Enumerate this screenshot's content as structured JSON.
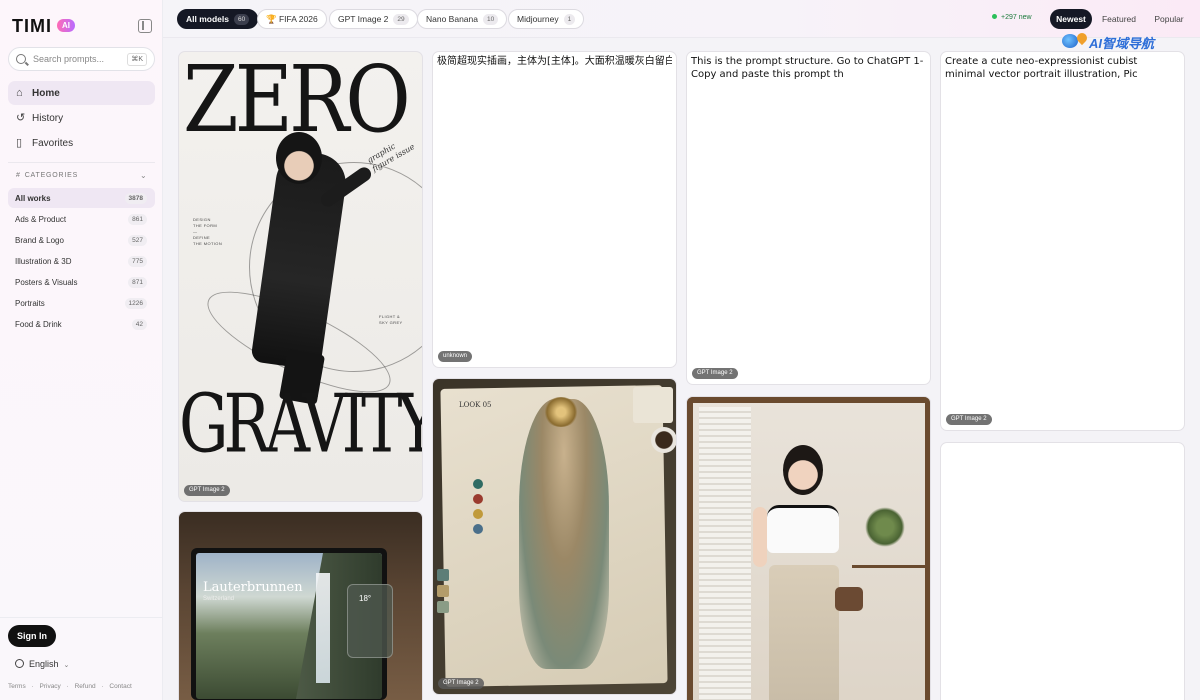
{
  "app": {
    "logo_text": "TIMI",
    "logo_badge": "AI"
  },
  "search": {
    "placeholder": "Search prompts...",
    "shortcut": "⌘K"
  },
  "nav": {
    "items": [
      {
        "label": "Home",
        "icon": "home-icon"
      },
      {
        "label": "History",
        "icon": "history-icon"
      },
      {
        "label": "Favorites",
        "icon": "bookmark-icon"
      }
    ]
  },
  "categories": {
    "heading": "CATEGORIES",
    "items": [
      {
        "label": "All works",
        "count": "3878"
      },
      {
        "label": "Ads & Product",
        "count": "861"
      },
      {
        "label": "Brand & Logo",
        "count": "527"
      },
      {
        "label": "Illustration & 3D",
        "count": "775"
      },
      {
        "label": "Posters & Visuals",
        "count": "871"
      },
      {
        "label": "Portraits",
        "count": "1226"
      },
      {
        "label": "Food & Drink",
        "count": "42"
      }
    ]
  },
  "account": {
    "signin_label": "Sign In",
    "language": "English"
  },
  "footer": {
    "links": [
      "Terms",
      "·",
      "Privacy",
      "·",
      "Refund",
      "·",
      "Contact"
    ]
  },
  "filters": {
    "models": [
      {
        "label": "All models",
        "count": "60"
      },
      {
        "label": "🏆 FIFA 2026",
        "count": ""
      },
      {
        "label": "GPT Image 2",
        "count": "29"
      },
      {
        "label": "Nano Banana",
        "count": "10"
      },
      {
        "label": "Midjourney",
        "count": "1"
      }
    ],
    "new_count": "+297 new",
    "sort": [
      "Newest",
      "Featured",
      "Popular"
    ]
  },
  "watermark": {
    "text": "AI智域导航"
  },
  "cards": {
    "zero_gravity": {
      "title_top": "ZERO",
      "title_bottom": "GRAVITY",
      "handwriting": "graphic figure issue",
      "tag": "GPT Image 2"
    },
    "laptop": {
      "heading": "Lauterbrunnen",
      "sub": "Switzerland",
      "temp": "18°",
      "tag": ""
    },
    "chinese_prompt": {
      "text": "极简超现实插画，主体为[主体]。大面积温暖灰白留白背",
      "tag": "unknown"
    },
    "map_art": {
      "title": "LOOK 05",
      "tag": "GPT Image 2"
    },
    "prompt_structure": {
      "text": "This is the prompt structure. Go to ChatGPT 1- Copy and paste this prompt th",
      "tag": "GPT Image 2"
    },
    "girl_photo": {
      "tag": ""
    },
    "cubist": {
      "text": "Create a cute neo-expressionist cubist minimal vector portrait illustration, Pic",
      "tag": "GPT Image 2"
    },
    "blank": {
      "tag": ""
    }
  }
}
